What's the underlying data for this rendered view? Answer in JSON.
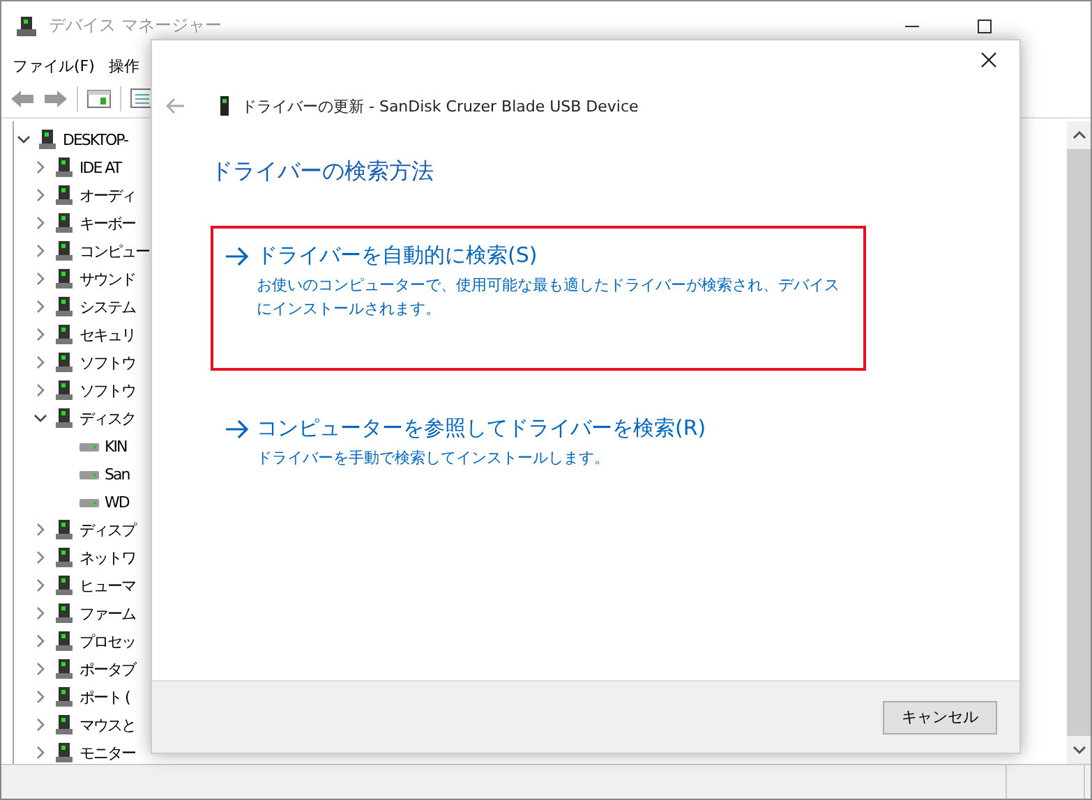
{
  "window": {
    "title": "デバイス マネージャー"
  },
  "menu": [
    "ファイル(F)",
    "操作"
  ],
  "tree": [
    {
      "label": "DESKTOP-",
      "expanded": true,
      "children": [
        {
          "label": "IDE AT",
          "expanded": false
        },
        {
          "label": "オーディ",
          "expanded": false
        },
        {
          "label": "キーボー",
          "expanded": false
        },
        {
          "label": "コンピュー",
          "expanded": false
        },
        {
          "label": "サウンド",
          "expanded": false
        },
        {
          "label": "システム",
          "expanded": false
        },
        {
          "label": "セキュリ",
          "expanded": false
        },
        {
          "label": "ソフトウ",
          "expanded": false
        },
        {
          "label": "ソフトウ",
          "expanded": false
        },
        {
          "label": "ディスク",
          "expanded": true,
          "children": [
            {
              "label": "KIN"
            },
            {
              "label": "San"
            },
            {
              "label": "WD"
            }
          ]
        },
        {
          "label": "ディスプ",
          "expanded": false
        },
        {
          "label": "ネットワ",
          "expanded": false
        },
        {
          "label": "ヒューマ",
          "expanded": false
        },
        {
          "label": "ファーム",
          "expanded": false
        },
        {
          "label": "プロセッ",
          "expanded": false
        },
        {
          "label": "ポータブ",
          "expanded": false
        },
        {
          "label": "ポート (",
          "expanded": false
        },
        {
          "label": "マウスと",
          "expanded": false
        },
        {
          "label": "モニター",
          "expanded": false
        }
      ]
    }
  ],
  "dialog": {
    "title": "ドライバーの更新 - SanDisk Cruzer Blade USB Device",
    "heading": "ドライバーの検索方法",
    "options": [
      {
        "title": "ドライバーを自動的に検索(S)",
        "description": "お使いのコンピューターで、使用可能な最も適したドライバーが検索され、デバイスにインストールされます。",
        "selected": true
      },
      {
        "title": "コンピューターを参照してドライバーを検索(R)",
        "description": "ドライバーを手動で検索してインストールします。",
        "selected": false
      }
    ],
    "buttons": [
      "キャンセル"
    ]
  }
}
